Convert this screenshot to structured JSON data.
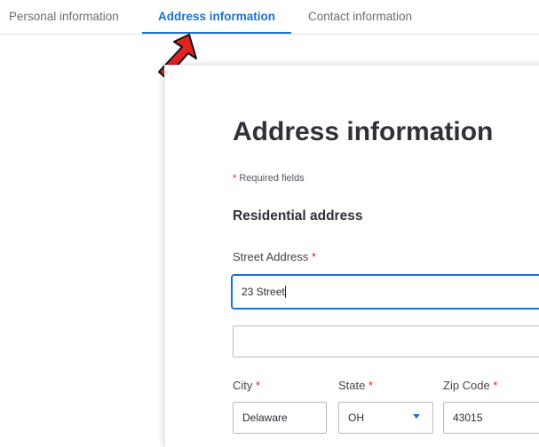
{
  "tabs": [
    {
      "label": "Personal information"
    },
    {
      "label": "Address information",
      "active": true
    },
    {
      "label": "Contact information"
    }
  ],
  "colors": {
    "accent": "#1b72c9",
    "required": "#e02020",
    "annotation_arrow": "#e32222"
  },
  "form": {
    "title": "Address information",
    "required_note": {
      "asterisk": "*",
      "text": " Required fields"
    },
    "section_title": "Residential address",
    "street": {
      "label": "Street Address",
      "asterisk": "*",
      "value": "23 Street"
    },
    "street2": {
      "value": ""
    },
    "city": {
      "label": "City",
      "asterisk": "*",
      "value": "Delaware"
    },
    "state": {
      "label": "State",
      "asterisk": "*",
      "value": "OH",
      "icon": "chevron-down-icon"
    },
    "zip": {
      "label": "Zip Code",
      "asterisk": "*",
      "value": "43015"
    }
  },
  "annotation": {
    "icon": "red-arrow-icon"
  }
}
